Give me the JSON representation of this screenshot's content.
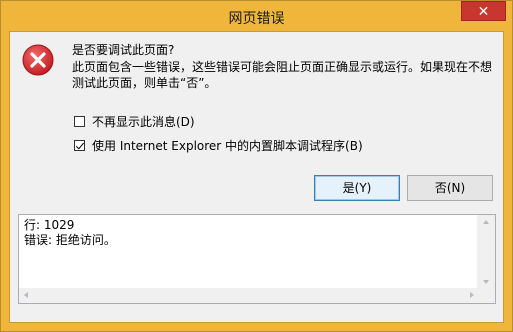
{
  "window": {
    "title": "网页错误",
    "close_label": "✕"
  },
  "message": {
    "question": "是否要调试此页面?",
    "body": "此页面包含一些错误，这些错误可能会阻止页面正确显示或运行。如果现在不想测试此页面，则单击“否”。"
  },
  "options": [
    {
      "label": "不再显示此消息(D)",
      "checked": false
    },
    {
      "label": "使用 Internet Explorer 中的内置脚本调试程序(B)",
      "checked": true
    }
  ],
  "buttons": {
    "yes_label": "是(Y)",
    "no_label": "否(N)"
  },
  "details": {
    "line1": "行: 1029",
    "line2": "错误: 拒绝访问。"
  },
  "colors": {
    "titlebar": "#f0b63c",
    "close": "#c7372f",
    "error_icon": "#d9272e"
  },
  "icons": {
    "error": "error-icon",
    "close": "close-icon"
  }
}
